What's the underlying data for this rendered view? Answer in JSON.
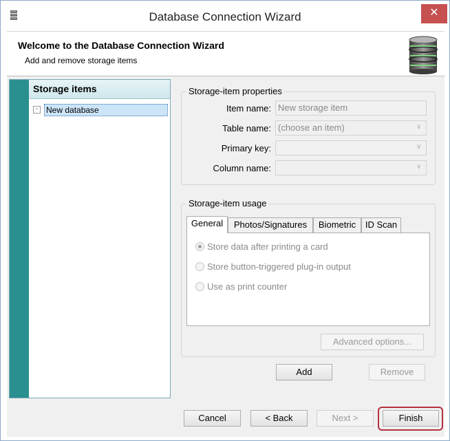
{
  "window": {
    "title": "Database Connection Wizard",
    "close_glyph": "✕",
    "app_icon": "database-app-icon"
  },
  "header": {
    "title": "Welcome to the Database Connection Wizard",
    "subtitle": "Add and remove storage items",
    "icon": "database-icon"
  },
  "storage_items": {
    "heading": "Storage items",
    "items": [
      {
        "expander": "-",
        "label": "New database"
      }
    ]
  },
  "properties": {
    "legend": "Storage-item properties",
    "item_name_label": "Item name:",
    "item_name_value": "New storage item",
    "table_name_label": "Table name:",
    "table_name_value": "(choose an item)",
    "primary_key_label": "Primary key:",
    "primary_key_value": "",
    "column_name_label": "Column name:",
    "column_name_value": ""
  },
  "usage": {
    "legend": "Storage-item usage",
    "tabs": [
      "General",
      "Photos/Signatures",
      "Biometric",
      "ID Scan"
    ],
    "active_tab": "General",
    "options": [
      {
        "label": "Store data after printing a card",
        "checked": true
      },
      {
        "label": "Store button-triggered plug-in output",
        "checked": false
      },
      {
        "label": "Use as print counter",
        "checked": false
      }
    ],
    "advanced_button": "Advanced options..."
  },
  "actions": {
    "add": "Add",
    "remove": "Remove"
  },
  "footer": {
    "cancel": "Cancel",
    "back": "< Back",
    "next": "Next >",
    "finish": "Finish"
  },
  "colors": {
    "accent_teal": "#2a8f8f",
    "close_red": "#c75050",
    "finish_highlight": "#b3313f",
    "selection": "#cce4f7"
  }
}
